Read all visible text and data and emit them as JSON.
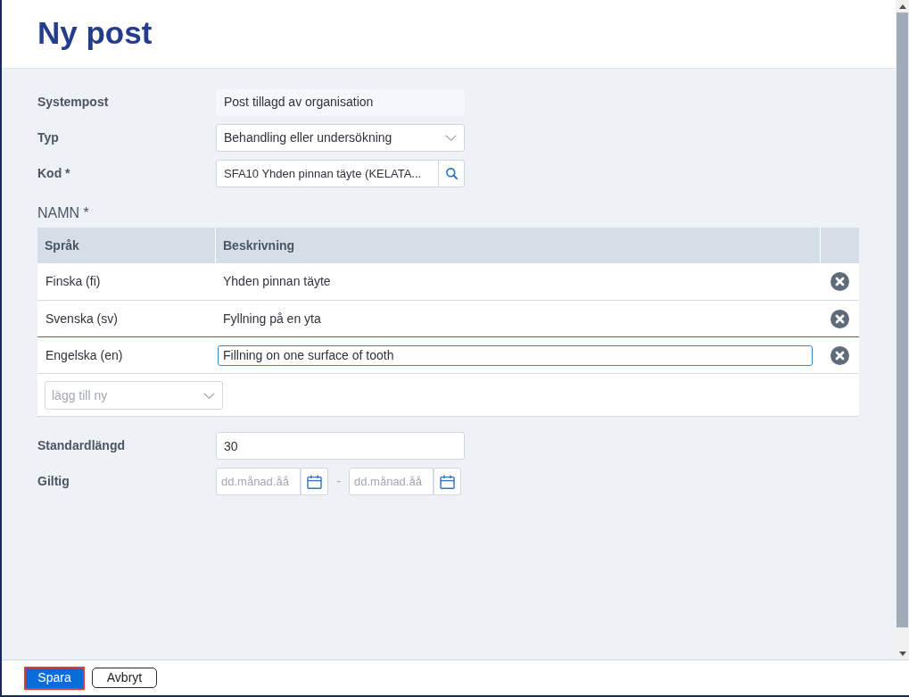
{
  "title": "Ny post",
  "form_top": [
    {
      "label": "Systempost",
      "kind": "readonly",
      "value": "Post tillagd av organisation"
    },
    {
      "label": "Typ",
      "kind": "select",
      "value": "Behandling eller undersökning"
    },
    {
      "label": "Kod *",
      "kind": "search",
      "value": "SFA10 Yhden pinnan täyte (KELATA..."
    }
  ],
  "names_section": {
    "label": "NAMN *",
    "columns": [
      "Språk",
      "Beskrivning"
    ],
    "rows": [
      {
        "language": "Finska (fi)",
        "description": "Yhden pinnan täyte",
        "editing": false
      },
      {
        "language": "Svenska (sv)",
        "description": "Fyllning på en yta",
        "editing": false
      },
      {
        "language": "Engelska (en)",
        "description": "Fillning on one surface of tooth",
        "editing": true
      }
    ],
    "add_language": {
      "placeholder": "lägg till ny"
    }
  },
  "form_bottom": [
    {
      "label": "Standardlängd",
      "kind": "text",
      "value": "30"
    },
    {
      "label": "Giltig",
      "kind": "daterange",
      "from_placeholder": "dd.månad.åå",
      "separator": "-",
      "to_placeholder": "dd.månad.åå"
    }
  ],
  "footer": {
    "buttons": [
      {
        "label": "Spara",
        "kind": "primary",
        "highlighted": true
      },
      {
        "label": "Avbryt",
        "kind": "secondary",
        "highlighted": false
      }
    ]
  }
}
